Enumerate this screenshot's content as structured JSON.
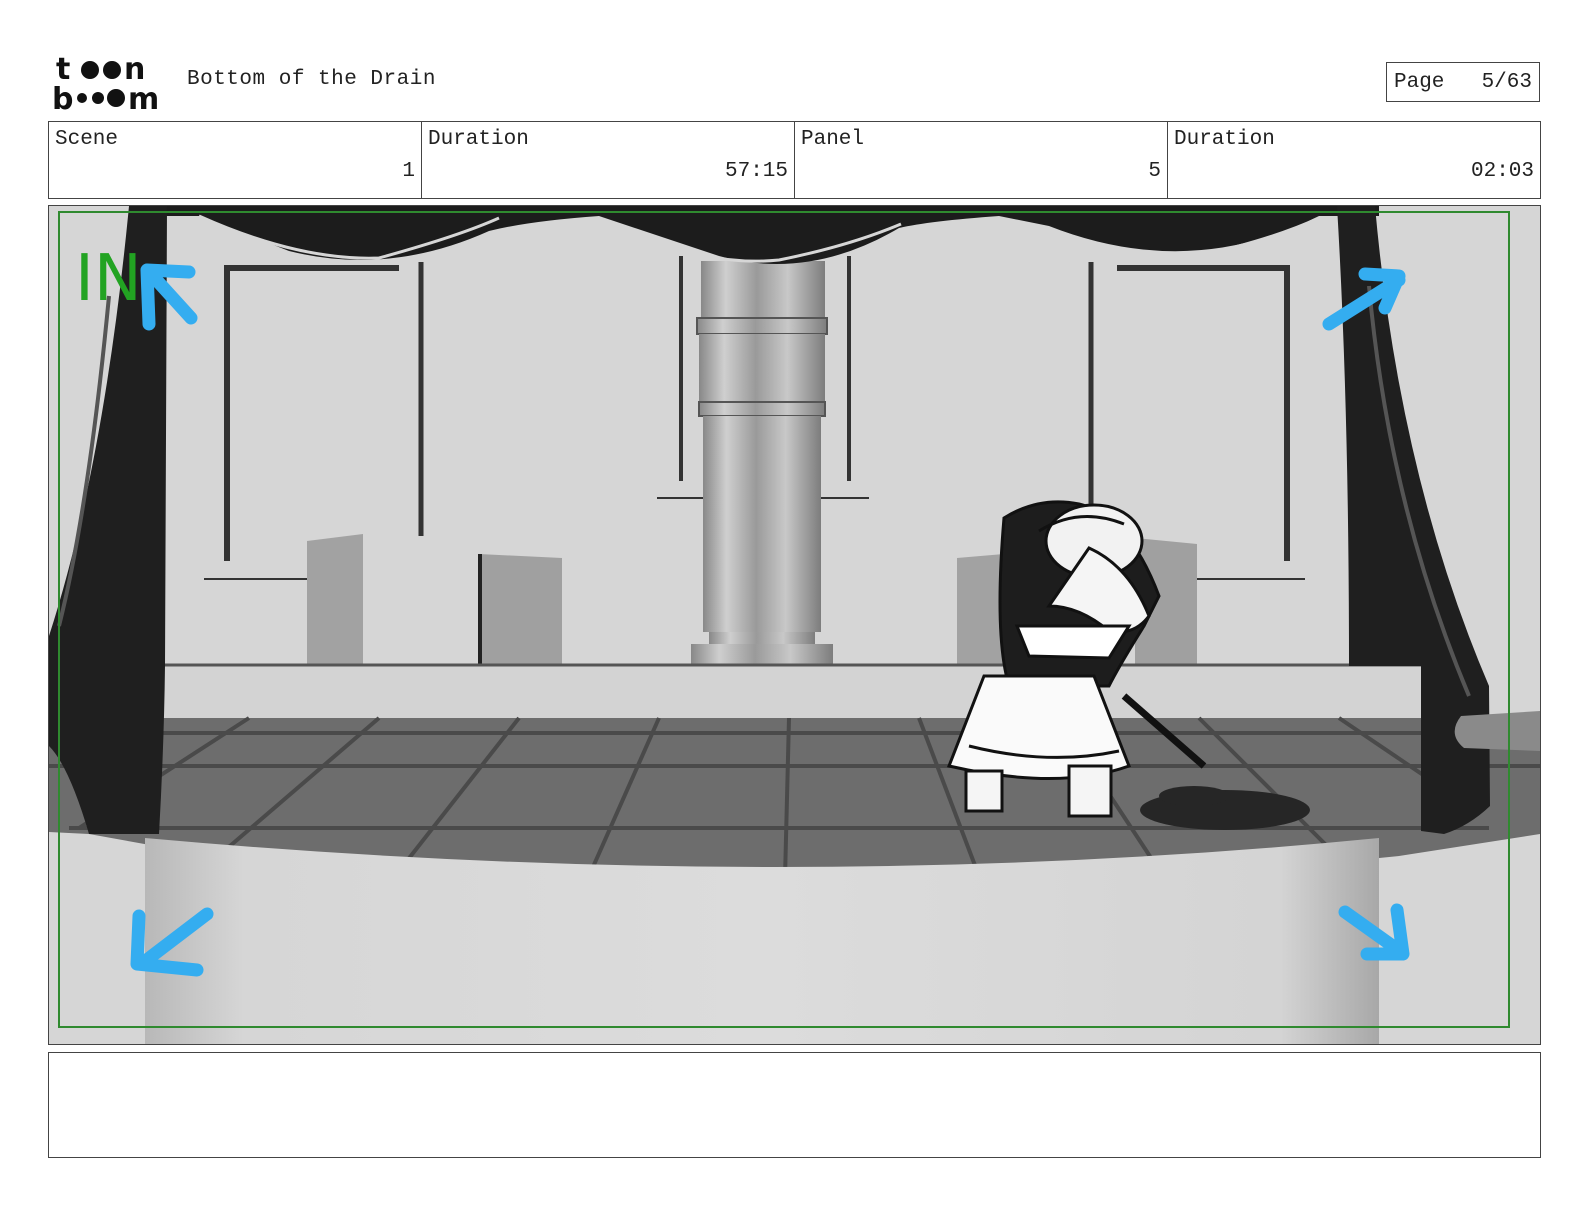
{
  "header": {
    "logo_text": "toon boom",
    "project_title": "Bottom of the Drain",
    "page_label": "Page",
    "page_value": "5/63"
  },
  "info": {
    "scene_label": "Scene",
    "scene_value": "1",
    "scene_duration_label": "Duration",
    "scene_duration_value": "57:15",
    "panel_label": "Panel",
    "panel_value": "5",
    "panel_duration_label": "Duration",
    "panel_duration_value": "02:03"
  },
  "panel_image": {
    "camera_move_text": "IN",
    "camera_move_color": "#22a322",
    "arrow_color": "#34adf0",
    "frame_color": "#2f8a2f"
  },
  "notes": {
    "text": ""
  }
}
